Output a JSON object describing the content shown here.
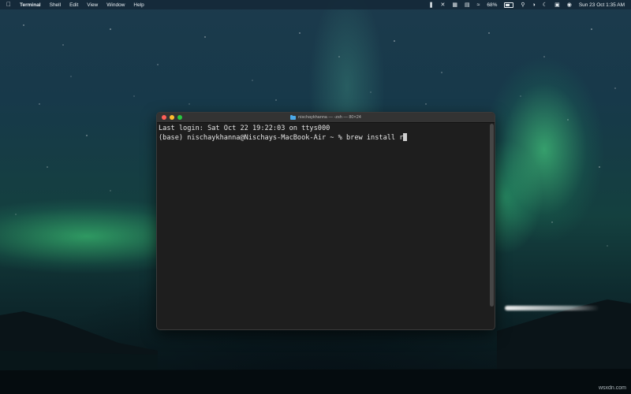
{
  "menubar": {
    "apple_icon": "apple-logo-icon",
    "app_name": "Terminal",
    "menus": [
      "Shell",
      "Edit",
      "View",
      "Window",
      "Help"
    ],
    "battery": "68%",
    "datetime": "Sun 23 Oct  1:35 AM"
  },
  "window": {
    "title": "nischaykhanna — -zsh — 80×24",
    "lines": {
      "login": "Last login: Sat Oct 22 19:22:03 on ttys000",
      "prompt": "(base) nischaykhanna@Nischays-MacBook-Air ~ % brew install r"
    }
  },
  "watermark": "wsxdn.com",
  "colors": {
    "terminal_bg": "#1e1e1e",
    "close": "#ff5f57",
    "minimize": "#febc2e",
    "zoom": "#28c840",
    "aurora": "#46e682"
  }
}
